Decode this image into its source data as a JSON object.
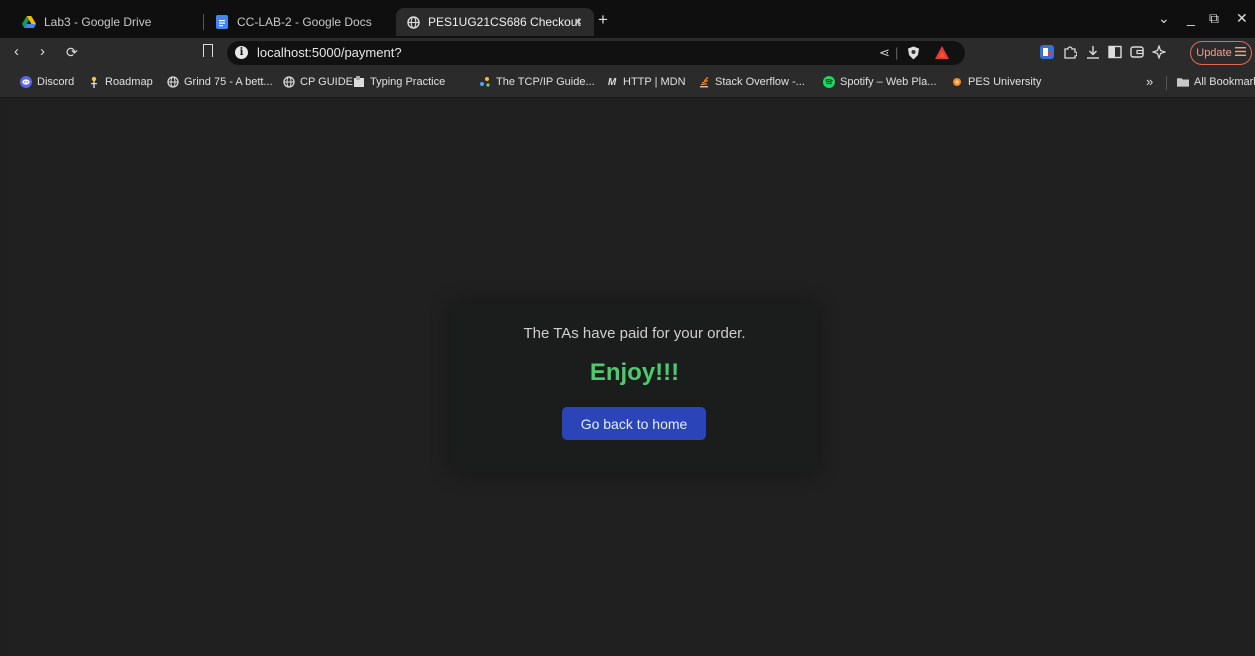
{
  "tabs": [
    {
      "title": "Lab3 - Google Drive"
    },
    {
      "title": "CC-LAB-2 - Google Docs"
    },
    {
      "title": "PES1UG21CS686 Checkout",
      "active": true,
      "close": "×"
    }
  ],
  "new_tab_label": "+",
  "window_controls": {
    "menu": "⌄",
    "minimize": "_",
    "restore": "⧉",
    "close": "✕"
  },
  "nav": {
    "back": "‹",
    "forward": "›",
    "reload": "⟳"
  },
  "address": {
    "url": "localhost:5000/payment?",
    "info_glyph": "i",
    "share_glyph": "⋖",
    "divider": "|"
  },
  "update_label": "Update",
  "bookmarks": [
    {
      "label": "Discord",
      "icon": "discord-icon"
    },
    {
      "label": "Roadmap",
      "icon": "roadmap-icon"
    },
    {
      "label": "Grind 75 - A bett...",
      "icon": "globe-icon"
    },
    {
      "label": "CP GUIDE",
      "icon": "globe-icon"
    },
    {
      "label": "Typing Practice",
      "icon": "typing-icon"
    },
    {
      "label": "The TCP/IP Guide...",
      "icon": "tcpip-icon"
    },
    {
      "label": "HTTP | MDN",
      "icon": "mdn-icon"
    },
    {
      "label": "Stack Overflow -...",
      "icon": "stackoverflow-icon"
    },
    {
      "label": "Spotify – Web Pla...",
      "icon": "spotify-icon"
    },
    {
      "label": "PES University",
      "icon": "pes-icon"
    }
  ],
  "bookmarks_overflow": "»",
  "all_bookmarks_label": "All Bookmarks",
  "card": {
    "message": "The TAs have paid for your order.",
    "title": "Enjoy!!!",
    "button_label": "Go back to home"
  },
  "colors": {
    "accent_green": "#4ccb6e",
    "button_blue": "#2b45b8"
  }
}
